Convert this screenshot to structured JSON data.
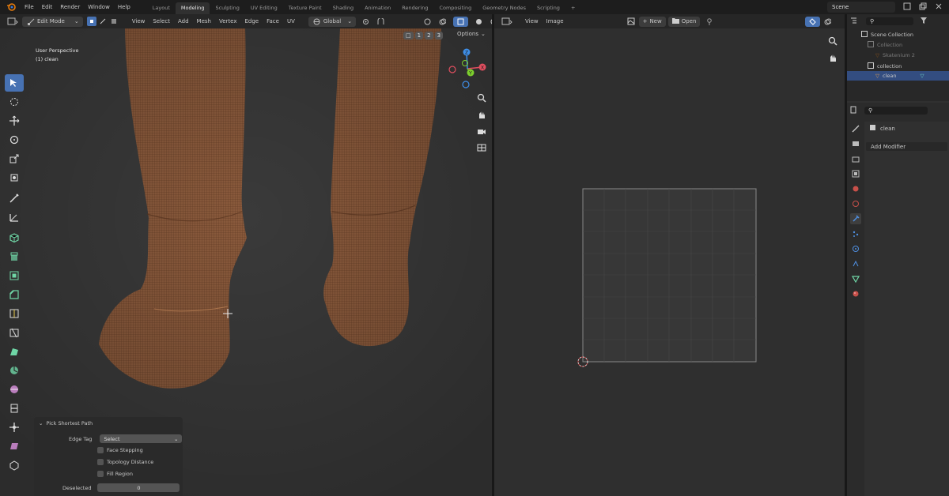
{
  "topbar": {
    "menus": [
      "File",
      "Edit",
      "Render",
      "Window",
      "Help"
    ],
    "workspaces": [
      "Layout",
      "Modeling",
      "Sculpting",
      "UV Editing",
      "Texture Paint",
      "Shading",
      "Animation",
      "Rendering",
      "Compositing",
      "Geometry Nodes",
      "Scripting"
    ],
    "active_workspace": "Modeling",
    "add_tab": "+",
    "scene": "Scene"
  },
  "viewport": {
    "mode": "Edit Mode",
    "menus": [
      "View",
      "Select",
      "Add",
      "Mesh",
      "Vertex",
      "Edge",
      "Face",
      "UV"
    ],
    "transform": "Global",
    "options": "Options",
    "perspective": "User Perspective",
    "object_label": "(1) clean",
    "axis_x": "X",
    "axis_y": "Y",
    "axis_z": "Z",
    "snap_numbers": [
      "1",
      "2",
      "3"
    ]
  },
  "operator_panel": {
    "title": "Pick Shortest Path",
    "edge_tag_label": "Edge Tag",
    "edge_tag_value": "Select",
    "options": [
      "Face Stepping",
      "Topology Distance",
      "Fill Region"
    ],
    "deselected_label": "Deselected",
    "deselected_value": "0"
  },
  "image_editor": {
    "menus": [
      "View",
      "Image"
    ],
    "new_button": "New",
    "open_button": "Open"
  },
  "outliner": {
    "root": "Scene Collection",
    "rows": [
      {
        "name": "Collection",
        "dim": true
      },
      {
        "name": "Skatenium 2",
        "dim": true
      },
      {
        "name": "collection",
        "dim": false
      },
      {
        "name": "clean",
        "dim": false,
        "selected": true
      }
    ]
  },
  "properties": {
    "object_name": "clean",
    "add_modifier": "Add Modifier"
  },
  "colors": {
    "accent": "#4772b3",
    "mesh": "#8a5a3c",
    "wire": "#5a3520",
    "axis_x": "#e04e5f",
    "axis_y": "#7dcf2e",
    "axis_z": "#3e8ee8",
    "mesh_tool": "#6fd6a6"
  }
}
